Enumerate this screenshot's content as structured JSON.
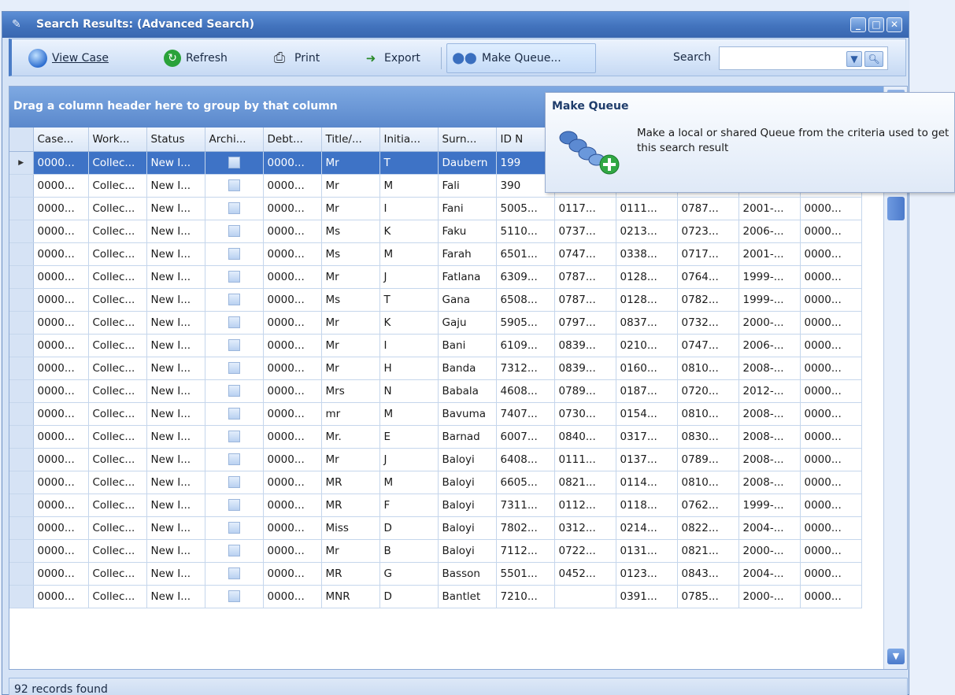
{
  "window": {
    "title": "Search Results: (Advanced Search)",
    "controls": [
      "minimize",
      "maximize",
      "close"
    ]
  },
  "toolbar": {
    "view_case": "View Case",
    "refresh": "Refresh",
    "print": "Print",
    "export": "Export",
    "make_queue": "Make Queue...",
    "search_label": "Search",
    "search_value": ""
  },
  "grid": {
    "group_hint": "Drag a column header here to group by that column",
    "columns": [
      "Case...",
      "Work...",
      "Status",
      "Archi...",
      "Debt...",
      "Title/...",
      "Initia...",
      "Surn...",
      "ID N",
      "",
      "",
      "",
      "",
      ""
    ],
    "rows": [
      [
        "0000...",
        "Collec...",
        "New I...",
        "",
        "0000...",
        "Mr",
        "T",
        "Daubern",
        "199",
        "",
        "",
        "",
        "",
        ""
      ],
      [
        "0000...",
        "Collec...",
        "New I...",
        "",
        "0000...",
        "Mr",
        "M",
        "Fali",
        "390",
        "",
        "",
        "",
        "",
        ""
      ],
      [
        "0000...",
        "Collec...",
        "New I...",
        "",
        "0000...",
        "Mr",
        "I",
        "Fani",
        "5005...",
        "0117...",
        "0111...",
        "0787...",
        "2001-...",
        "0000..."
      ],
      [
        "0000...",
        "Collec...",
        "New I...",
        "",
        "0000...",
        "Ms",
        "K",
        "Faku",
        "5110...",
        "0737...",
        "0213...",
        "0723...",
        "2006-...",
        "0000..."
      ],
      [
        "0000...",
        "Collec...",
        "New I...",
        "",
        "0000...",
        "Ms",
        "M",
        "Farah",
        "6501...",
        "0747...",
        "0338...",
        "0717...",
        "2001-...",
        "0000..."
      ],
      [
        "0000...",
        "Collec...",
        "New I...",
        "",
        "0000...",
        "Mr",
        "J",
        "Fatlana",
        "6309...",
        "0787...",
        "0128...",
        "0764...",
        "1999-...",
        "0000..."
      ],
      [
        "0000...",
        "Collec...",
        "New I...",
        "",
        "0000...",
        "Ms",
        "T",
        "Gana",
        "6508...",
        "0787...",
        "0128...",
        "0782...",
        "1999-...",
        "0000..."
      ],
      [
        "0000...",
        "Collec...",
        "New I...",
        "",
        "0000...",
        "Mr",
        "K",
        "Gaju",
        "5905...",
        "0797...",
        "0837...",
        "0732...",
        "2000-...",
        "0000..."
      ],
      [
        "0000...",
        "Collec...",
        "New I...",
        "",
        "0000...",
        "Mr",
        "I",
        "Bani",
        "6109...",
        "0839...",
        "0210...",
        "0747...",
        "2006-...",
        "0000..."
      ],
      [
        "0000...",
        "Collec...",
        "New I...",
        "",
        "0000...",
        "Mr",
        "H",
        "Banda",
        "7312...",
        "0839...",
        "0160...",
        "0810...",
        "2008-...",
        "0000..."
      ],
      [
        "0000...",
        "Collec...",
        "New I...",
        "",
        "0000...",
        "Mrs",
        "N",
        "Babala",
        "4608...",
        "0789...",
        "0187...",
        "0720...",
        "2012-...",
        "0000..."
      ],
      [
        "0000...",
        "Collec...",
        "New I...",
        "",
        "0000...",
        "mr",
        "M",
        "Bavuma",
        "7407...",
        "0730...",
        "0154...",
        "0810...",
        "2008-...",
        "0000..."
      ],
      [
        "0000...",
        "Collec...",
        "New I...",
        "",
        "0000...",
        "Mr.",
        "E",
        "Barnad",
        "6007...",
        "0840...",
        "0317...",
        "0830...",
        "2008-...",
        "0000..."
      ],
      [
        "0000...",
        "Collec...",
        "New I...",
        "",
        "0000...",
        "Mr",
        "J",
        "Baloyi",
        "6408...",
        "0111...",
        "0137...",
        "0789...",
        "2008-...",
        "0000..."
      ],
      [
        "0000...",
        "Collec...",
        "New I...",
        "",
        "0000...",
        "MR",
        "M",
        "Baloyi",
        "6605...",
        "0821...",
        "0114...",
        "0810...",
        "2008-...",
        "0000..."
      ],
      [
        "0000...",
        "Collec...",
        "New I...",
        "",
        "0000...",
        "MR",
        "F",
        "Baloyi",
        "7311...",
        "0112...",
        "0118...",
        "0762...",
        "1999-...",
        "0000..."
      ],
      [
        "0000...",
        "Collec...",
        "New I...",
        "",
        "0000...",
        "Miss",
        "D",
        "Baloyi",
        "7802...",
        "0312...",
        "0214...",
        "0822...",
        "2004-...",
        "0000..."
      ],
      [
        "0000...",
        "Collec...",
        "New I...",
        "",
        "0000...",
        "Mr",
        "B",
        "Baloyi",
        "7112...",
        "0722...",
        "0131...",
        "0821...",
        "2000-...",
        "0000..."
      ],
      [
        "0000...",
        "Collec...",
        "New I...",
        "",
        "0000...",
        "MR",
        "G",
        "Basson",
        "5501...",
        "0452...",
        "0123...",
        "0843...",
        "2004-...",
        "0000..."
      ],
      [
        "0000...",
        "Collec...",
        "New I...",
        "",
        "0000...",
        "MNR",
        "D",
        "Bantlet",
        "7210...",
        "",
        "0391...",
        "0785...",
        "2000-...",
        "0000..."
      ]
    ]
  },
  "status": {
    "text": "92 records found"
  },
  "tooltip": {
    "title": "Make Queue",
    "body": "Make a local or shared Queue from the criteria used to get this search result"
  },
  "colors": {
    "titlebar": "#4273bd",
    "selection": "#3e73c6",
    "groupbar": "#6b97d7"
  }
}
